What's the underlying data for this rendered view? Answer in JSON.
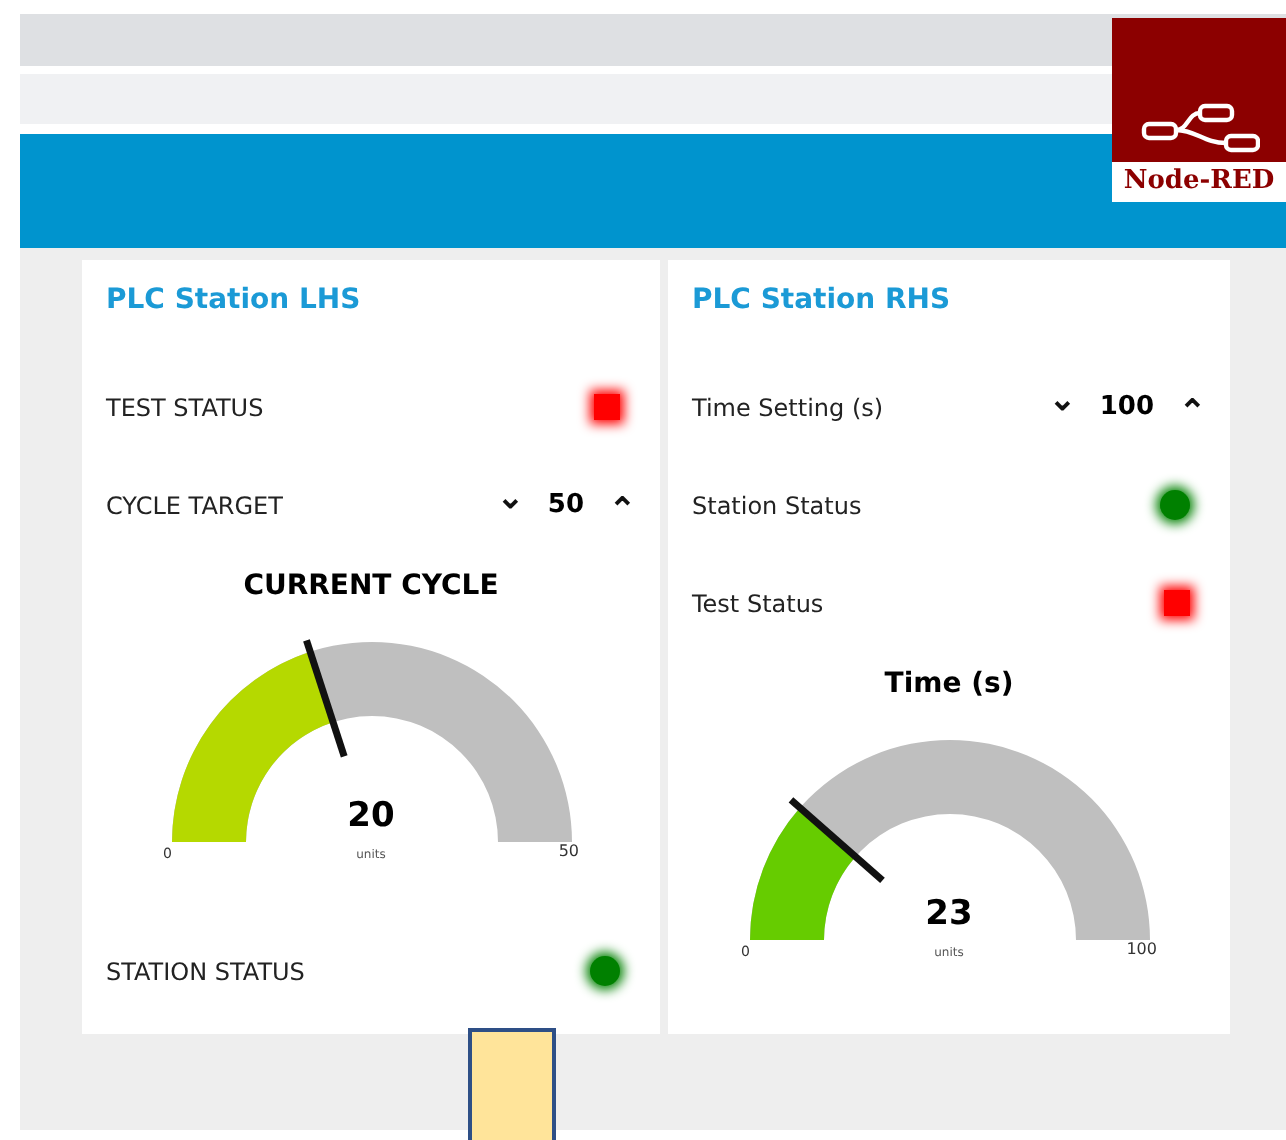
{
  "logo": {
    "text": "Node-RED"
  },
  "groups": [
    {
      "title": "PLC Station LHS",
      "rows": [
        {
          "kind": "lamp",
          "label": "TEST STATUS",
          "color": "#ff0000"
        },
        {
          "kind": "numeric",
          "label": "CYCLE TARGET",
          "down": "⌄",
          "value": "50",
          "up": "⌃"
        },
        {
          "kind": "gauge",
          "title": "CURRENT CYCLE",
          "value": "20",
          "units": "units",
          "min": "0",
          "max": "50",
          "level": 0.4,
          "color": "#b5d900"
        },
        {
          "kind": "dot",
          "label": "STATION STATUS",
          "color": "#008000"
        }
      ]
    },
    {
      "title": "PLC Station RHS",
      "rows": [
        {
          "kind": "numeric",
          "label": "Time Setting (s)",
          "down": "⌄",
          "value": "100",
          "up": "⌃"
        },
        {
          "kind": "dot",
          "label": "Station Status",
          "color": "#008000"
        },
        {
          "kind": "lamp",
          "label": "Test Status",
          "color": "#ff0000"
        },
        {
          "kind": "gauge",
          "title": "Time (s)",
          "value": "23",
          "units": "units",
          "min": "0",
          "max": "100",
          "level": 0.23,
          "color": "#66cc00"
        }
      ]
    }
  ]
}
